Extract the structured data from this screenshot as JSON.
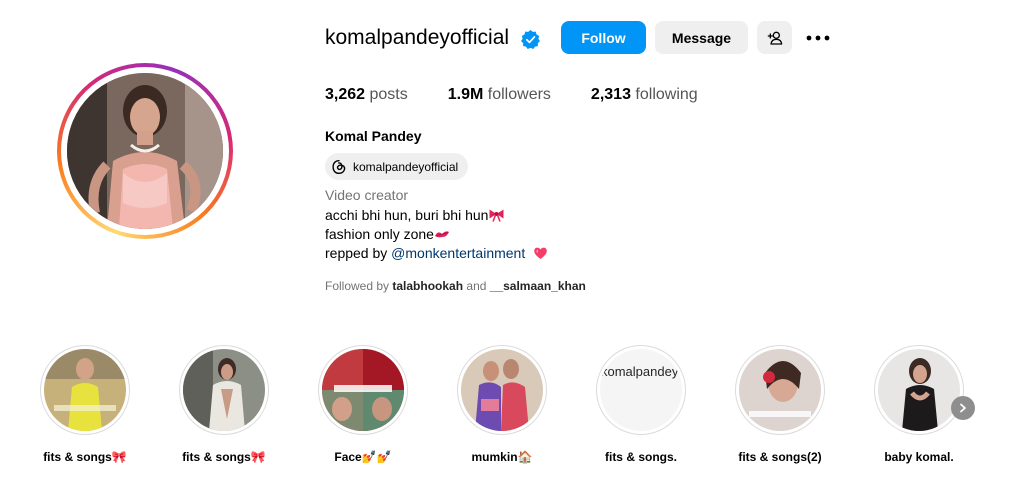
{
  "profile": {
    "username": "komalpandeyofficial",
    "verified_icon": "verified-badge-icon",
    "follow_label": "Follow",
    "message_label": "Message",
    "add_user_icon": "add-user-icon",
    "more_icon": "more-options-icon"
  },
  "stats": {
    "posts_count": "3,262",
    "posts_label": "posts",
    "followers_count": "1.9M",
    "followers_label": "followers",
    "following_count": "2,313",
    "following_label": "following"
  },
  "bio": {
    "full_name": "Komal Pandey",
    "threads_handle": "komalpandeyofficial",
    "category": "Video creator",
    "line1": "acchi bhi hun, buri bhi hun",
    "line2": "fashion only zone",
    "line3_prefix": "repped by ",
    "line3_link": "@monkentertainment",
    "followed_by_prefix": "Followed by ",
    "followed_by_user1": "talabhookah",
    "followed_by_and": " and ",
    "followed_by_user2": "__salmaan_khan"
  },
  "highlights": [
    {
      "label": "fits & songs",
      "emoji": "🎀"
    },
    {
      "label": "fits & songs",
      "emoji": "🎀"
    },
    {
      "label": "Face",
      "emoji": "💅💅"
    },
    {
      "label": "mumkin",
      "emoji": "🏠"
    },
    {
      "label": "fits & songs.",
      "emoji": "",
      "broken_alt": "komalpandeyofficial's highlight story picture"
    },
    {
      "label": "fits & songs(2)",
      "emoji": ""
    },
    {
      "label": "baby komal.",
      "emoji": ""
    }
  ],
  "colors": {
    "accent": "#0095f6",
    "secondary_button": "#efefef",
    "link": "#00376b",
    "muted_text": "#737373"
  }
}
